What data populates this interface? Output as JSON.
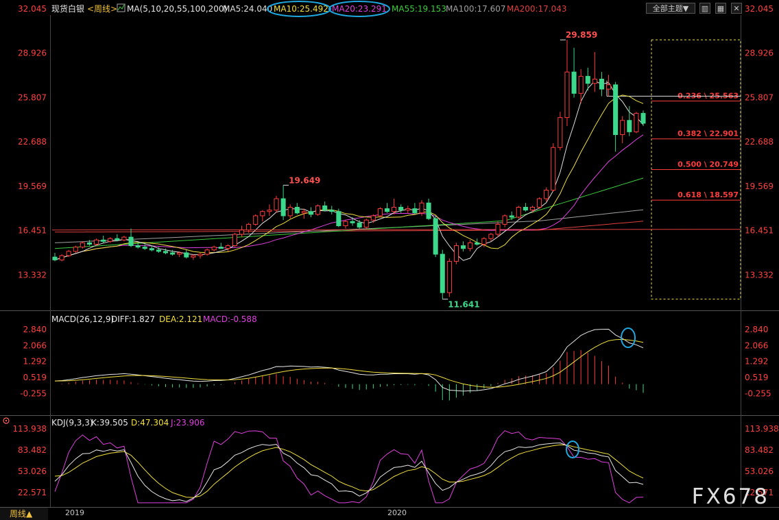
{
  "header": {
    "symbol": "现货白银",
    "period": "<周线>",
    "ma_title": "MA(5,10,20,55,100,200)",
    "ma": [
      {
        "label": "MA5:24.040",
        "color": "#e0e0e0"
      },
      {
        "label": "MA10:25.492",
        "color": "#f2e03c"
      },
      {
        "label": "MA20:23.291",
        "color": "#e040e0"
      },
      {
        "label": "MA55:19.153",
        "color": "#3ccc3c"
      },
      {
        "label": "MA100:17.607",
        "color": "#a0a0a0"
      },
      {
        "label": "MA200:17.043",
        "color": "#e04040"
      }
    ],
    "theme_button": "全部主题▼"
  },
  "bottom": {
    "period_button": "周线▲",
    "years": [
      "2019",
      "2020"
    ]
  },
  "watermark": "FX678",
  "colors": {
    "up": "#ff3c3c",
    "down": "#3cd88c",
    "ma5": "#e0e0e0",
    "ma10": "#f2e03c",
    "ma20": "#e040e0",
    "ma55": "#3ccc3c",
    "ma100": "#a0a0a0",
    "ma200": "#e04040",
    "circle": "#1fa8e0",
    "fib": "#ff3c3c",
    "box": "#f2e03c"
  },
  "chart_data": [
    {
      "type": "candlestick",
      "title": "现货白银<周线>",
      "ylim": [
        11.0,
        31.6
      ],
      "y_ticks": [
        "32.045",
        "28.926",
        "25.807",
        "22.688",
        "19.569",
        "16.451",
        "13.332"
      ],
      "annotations": [
        {
          "label": "29.859",
          "value": 29.859,
          "index": 73
        },
        {
          "label": "19.649",
          "value": 19.649,
          "index": 33
        },
        {
          "label": "11.641",
          "value": 11.641,
          "index": 56
        }
      ],
      "fibonacci": [
        {
          "label": "0.236 \\ 25.563",
          "value": 25.563
        },
        {
          "label": "0.382 \\ 22.901",
          "value": 22.901
        },
        {
          "label": "0.500 \\ 20.749",
          "value": 20.749
        },
        {
          "label": "0.618 \\ 18.597",
          "value": 18.597
        }
      ],
      "ohlc": [
        [
          14.6,
          14.9,
          14.3,
          14.4
        ],
        [
          14.4,
          14.8,
          14.3,
          14.7
        ],
        [
          14.7,
          15.1,
          14.6,
          15.0
        ],
        [
          15.0,
          15.4,
          14.9,
          15.3
        ],
        [
          15.3,
          15.7,
          15.2,
          15.6
        ],
        [
          15.6,
          15.8,
          15.4,
          15.5
        ],
        [
          15.5,
          15.9,
          15.4,
          15.8
        ],
        [
          15.8,
          16.1,
          15.6,
          15.7
        ],
        [
          15.7,
          16.0,
          15.6,
          15.9
        ],
        [
          15.9,
          16.2,
          15.7,
          15.8
        ],
        [
          15.8,
          16.1,
          15.7,
          16.0
        ],
        [
          16.0,
          16.6,
          15.3,
          15.4
        ],
        [
          15.4,
          15.6,
          15.2,
          15.3
        ],
        [
          15.3,
          15.5,
          15.1,
          15.2
        ],
        [
          15.2,
          15.4,
          15.0,
          15.1
        ],
        [
          15.1,
          15.3,
          14.9,
          15.0
        ],
        [
          15.0,
          15.2,
          14.8,
          14.9
        ],
        [
          14.9,
          15.1,
          14.7,
          14.8
        ],
        [
          14.8,
          15.0,
          14.6,
          14.9
        ],
        [
          14.9,
          15.1,
          14.5,
          14.6
        ],
        [
          14.6,
          14.8,
          14.4,
          14.7
        ],
        [
          14.7,
          14.9,
          14.5,
          14.8
        ],
        [
          14.8,
          15.2,
          14.7,
          15.1
        ],
        [
          15.1,
          15.4,
          15.0,
          15.3
        ],
        [
          15.3,
          15.6,
          15.2,
          15.2
        ],
        [
          15.2,
          15.5,
          15.0,
          15.4
        ],
        [
          15.4,
          16.3,
          15.3,
          16.2
        ],
        [
          16.2,
          16.8,
          16.0,
          16.5
        ],
        [
          16.5,
          17.0,
          16.3,
          16.9
        ],
        [
          16.9,
          17.6,
          16.8,
          17.5
        ],
        [
          17.5,
          17.9,
          17.1,
          17.8
        ],
        [
          17.8,
          18.3,
          17.5,
          17.9
        ],
        [
          17.9,
          18.9,
          17.7,
          18.7
        ],
        [
          18.7,
          19.649,
          17.2,
          17.5
        ],
        [
          17.5,
          18.3,
          17.3,
          18.1
        ],
        [
          18.1,
          18.4,
          17.6,
          17.7
        ],
        [
          17.7,
          18.0,
          17.3,
          17.8
        ],
        [
          17.8,
          18.1,
          17.4,
          17.6
        ],
        [
          17.6,
          18.3,
          17.5,
          18.2
        ],
        [
          18.2,
          18.5,
          17.8,
          17.9
        ],
        [
          17.9,
          18.2,
          17.6,
          17.8
        ],
        [
          17.8,
          18.0,
          16.7,
          16.8
        ],
        [
          16.8,
          17.2,
          16.6,
          17.1
        ],
        [
          17.1,
          17.4,
          16.8,
          17.0
        ],
        [
          17.0,
          17.2,
          16.6,
          16.7
        ],
        [
          16.7,
          17.3,
          16.6,
          17.2
        ],
        [
          17.2,
          17.6,
          17.0,
          17.5
        ],
        [
          17.5,
          18.1,
          17.4,
          18.0
        ],
        [
          18.0,
          18.4,
          17.7,
          17.8
        ],
        [
          17.8,
          18.7,
          17.6,
          18.1
        ],
        [
          18.1,
          18.3,
          17.7,
          17.9
        ],
        [
          17.9,
          18.2,
          17.7,
          18.0
        ],
        [
          18.0,
          18.4,
          17.6,
          17.7
        ],
        [
          17.7,
          18.6,
          17.5,
          18.4
        ],
        [
          18.4,
          18.7,
          17.2,
          17.3
        ],
        [
          17.3,
          17.5,
          14.6,
          14.8
        ],
        [
          14.8,
          15.1,
          11.641,
          12.1
        ],
        [
          12.1,
          14.5,
          11.8,
          14.3
        ],
        [
          14.3,
          15.6,
          14.1,
          15.4
        ],
        [
          15.4,
          15.7,
          15.0,
          15.2
        ],
        [
          15.2,
          15.8,
          15.0,
          15.6
        ],
        [
          15.6,
          15.9,
          15.4,
          15.5
        ],
        [
          15.5,
          16.0,
          15.3,
          15.9
        ],
        [
          15.9,
          16.3,
          15.7,
          16.2
        ],
        [
          16.2,
          17.1,
          16.0,
          16.9
        ],
        [
          16.9,
          17.6,
          16.7,
          17.5
        ],
        [
          17.5,
          17.8,
          17.2,
          17.4
        ],
        [
          17.4,
          18.2,
          17.3,
          18.1
        ],
        [
          18.1,
          18.4,
          17.8,
          17.9
        ],
        [
          17.9,
          18.2,
          17.7,
          18.1
        ],
        [
          18.1,
          18.8,
          18.0,
          18.7
        ],
        [
          18.7,
          19.5,
          18.5,
          19.3
        ],
        [
          19.3,
          22.6,
          19.2,
          22.3
        ],
        [
          22.3,
          24.8,
          22.1,
          24.4
        ],
        [
          24.4,
          29.859,
          23.8,
          27.6
        ],
        [
          27.6,
          29.3,
          25.8,
          26.1
        ],
        [
          26.1,
          27.8,
          25.4,
          27.3
        ],
        [
          27.3,
          27.9,
          26.3,
          26.8
        ],
        [
          26.8,
          29.0,
          26.2,
          27.1
        ],
        [
          27.1,
          27.6,
          25.9,
          26.4
        ],
        [
          26.4,
          27.4,
          25.9,
          26.7
        ],
        [
          26.7,
          26.9,
          22.0,
          23.2
        ],
        [
          23.2,
          24.5,
          22.6,
          24.2
        ],
        [
          24.2,
          25.2,
          23.1,
          23.4
        ],
        [
          23.4,
          24.8,
          23.3,
          24.7
        ],
        [
          24.7,
          24.9,
          23.8,
          24.0
        ]
      ]
    },
    {
      "type": "macd",
      "title": "MACD(26,12,9)",
      "labels": [
        "DIFF:1.827",
        "DEA:2.121",
        "MACD:-0.588"
      ],
      "y_ticks": [
        "2.840",
        "2.066",
        "1.292",
        "0.519",
        "-0.255"
      ],
      "ylim": [
        -1.2,
        3.2
      ]
    },
    {
      "type": "kdj",
      "title": "KDJ(9,3,3)",
      "labels": [
        "K:39.505",
        "D:47.304",
        "J:23.906"
      ],
      "y_ticks": [
        "113.938",
        "83.482",
        "53.026",
        "22.571"
      ],
      "ylim": [
        5,
        118
      ]
    }
  ]
}
